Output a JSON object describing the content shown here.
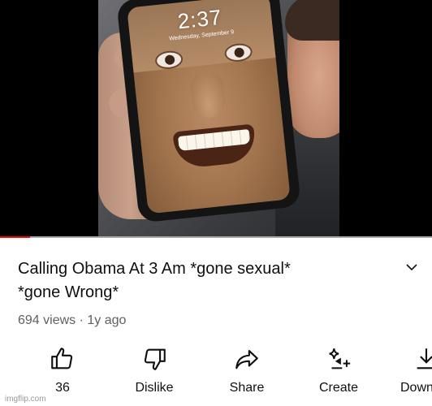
{
  "player": {
    "lockscreen_time": "2:37",
    "lockscreen_date": "Wednesday, September 9",
    "progress_fraction": 0.07
  },
  "video": {
    "title_line1": "Calling Obama At 3 Am *gone sexual*",
    "title_line2": "*gone Wrong*",
    "views": "694 views",
    "separator": "·",
    "age": "1y ago"
  },
  "actions": {
    "like_count": "36",
    "dislike_label": "Dislike",
    "share_label": "Share",
    "create_label": "Create",
    "download_label": "Down"
  },
  "watermark": "imgflip.com",
  "icons": {
    "expand": "chevron-down-icon",
    "like": "thumbs-up-icon",
    "dislike": "thumbs-down-icon",
    "share": "share-arrow-icon",
    "create": "create-sparkle-icon",
    "download": "download-icon"
  },
  "colors": {
    "progress_played": "#ff0000",
    "progress_track": "#a6a6a6",
    "meta_text": "#606060"
  }
}
